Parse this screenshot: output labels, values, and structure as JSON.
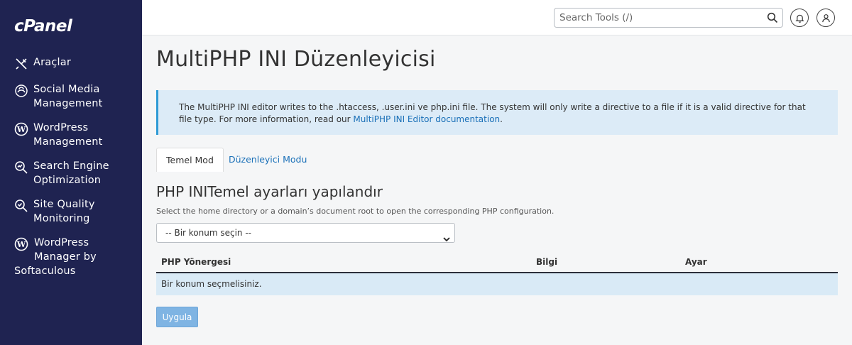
{
  "brand": {
    "logo_text": "cPanel"
  },
  "sidebar": {
    "items": [
      {
        "label": "Araçlar",
        "icon": "tools-icon"
      },
      {
        "label_lines": [
          "Social Media",
          "Management"
        ],
        "icon": "social-media-icon"
      },
      {
        "label_lines": [
          "WordPress",
          "Management"
        ],
        "icon": "wordpress-icon"
      },
      {
        "label_lines": [
          "Search Engine",
          "Optimization"
        ],
        "icon": "seo-icon"
      },
      {
        "label_lines": [
          "Site Quality",
          "Monitoring"
        ],
        "icon": "site-quality-icon"
      },
      {
        "label_lines": [
          "WordPress",
          "Manager by",
          "Softaculous"
        ],
        "icon": "wordpress-icon"
      }
    ]
  },
  "topbar": {
    "search_placeholder": "Search Tools (/)",
    "icons": [
      "search-icon",
      "bell-icon",
      "user-icon"
    ]
  },
  "page": {
    "title": "MultiPHP INI Düzenleyicisi",
    "info_text": "The MultiPHP INI editor writes to the .htaccess, .user.ini ve php.ini file. The system will only write a directive to a file if it is a valid directive for that file type. For more information, read our ",
    "info_link": "MultiPHP INI Editor documentation",
    "info_end": "."
  },
  "tabs": [
    {
      "label": "Temel Mod",
      "active": true
    },
    {
      "label": "Düzenleyici Modu",
      "active": false
    }
  ],
  "section": {
    "title": "PHP INITemel ayarları yapılandır",
    "subtitle": "Select the home directory or a domain’s document root to open the corresponding PHP configuration."
  },
  "location_select": {
    "selected": "-- Bir konum seçin --"
  },
  "table": {
    "headers": [
      "PHP Yönergesi",
      "Bilgi",
      "Ayar"
    ],
    "empty_message": "Bir konum seçmelisiniz."
  },
  "buttons": {
    "apply": "Uygula"
  },
  "colors": {
    "sidebar_bg": "#1f2351",
    "info_bg": "#dcebf7",
    "info_border": "#2f9bd5",
    "link": "#1a70b8",
    "apply_bg": "#7fb4e3"
  }
}
